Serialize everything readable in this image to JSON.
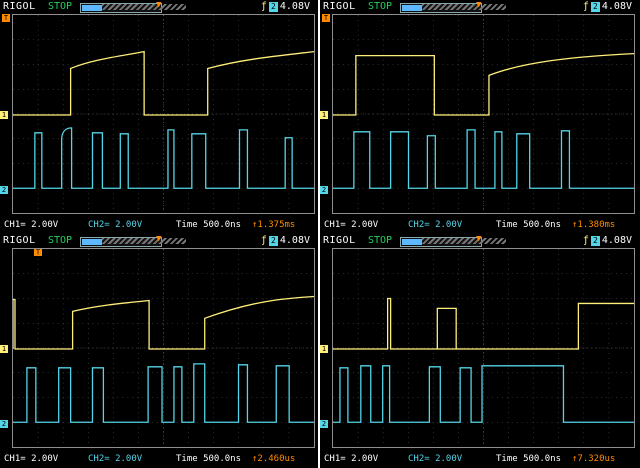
{
  "screens": [
    {
      "brand": "RIGOL",
      "state": "STOP",
      "trigger_channel": "2",
      "trigger_level": "4.08V",
      "ch1": "CH1= 2.00V",
      "ch2": "CH2= 2.00V",
      "time": "Time 500.0ns",
      "trigger_time": "↑1.375ms"
    },
    {
      "brand": "RIGOL",
      "state": "STOP",
      "trigger_channel": "2",
      "trigger_level": "4.08V",
      "ch1": "CH1= 2.00V",
      "ch2": "CH2= 2.00V",
      "time": "Time 500.0ns",
      "trigger_time": "↑1.380ms"
    },
    {
      "brand": "RIGOL",
      "state": "STOP",
      "trigger_channel": "2",
      "trigger_level": "4.08V",
      "ch1": "CH1= 2.00V",
      "ch2": "CH2= 2.00V",
      "time": "Time 500.0ns",
      "trigger_time": "↑2.460us"
    },
    {
      "brand": "RIGOL",
      "state": "STOP",
      "trigger_channel": "2",
      "trigger_level": "4.08V",
      "ch1": "CH1= 2.00V",
      "ch2": "CH2= 2.00V",
      "time": "Time 500.0ns",
      "trigger_time": "↑7.320us"
    }
  ],
  "colors": {
    "ch1": "#ffef7a",
    "ch2": "#55d5e8",
    "grid": "#5c5c5c",
    "trigger": "#ff8c00"
  }
}
